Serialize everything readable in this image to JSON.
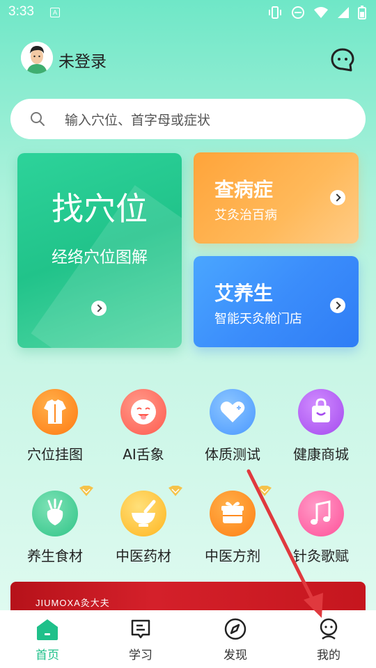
{
  "status_bar": {
    "time": "3:33",
    "notification_glyph": "A"
  },
  "header": {
    "user_name": "未登录"
  },
  "search": {
    "placeholder": "输入穴位、首字母或症状"
  },
  "cards": {
    "main": {
      "title": "找穴位",
      "subtitle": "经络穴位图解"
    },
    "disease": {
      "title": "查病症",
      "subtitle": "艾灸治百病"
    },
    "health": {
      "title": "艾养生",
      "subtitle": "智能天灸舱门店"
    }
  },
  "grid": [
    {
      "label": "穴位挂图",
      "icon": "shirt-icon",
      "color": "#ff8a1f"
    },
    {
      "label": "AI舌象",
      "icon": "face-icon",
      "color": "#ff6a5e"
    },
    {
      "label": "体质测试",
      "icon": "heart-icon",
      "color": "#5aa9ff"
    },
    {
      "label": "健康商城",
      "icon": "shopping-bag-icon",
      "color": "#b25cf0"
    },
    {
      "label": "养生食材",
      "icon": "radish-icon",
      "color": "#35c98e",
      "vip": true
    },
    {
      "label": "中医药材",
      "icon": "mortar-icon",
      "color": "#ffbf2e",
      "vip": true
    },
    {
      "label": "中医方剂",
      "icon": "gift-box-icon",
      "color": "#ff8a1f",
      "vip": true
    },
    {
      "label": "针灸歌赋",
      "icon": "music-note-icon",
      "color": "#ff5fa0"
    }
  ],
  "banner": {
    "text": "JIUMOXA灸大夫"
  },
  "tabs": [
    {
      "label": "首页",
      "icon": "home-icon",
      "active": true
    },
    {
      "label": "学习",
      "icon": "notes-icon",
      "active": false
    },
    {
      "label": "发现",
      "icon": "compass-icon",
      "active": false
    },
    {
      "label": "我的",
      "icon": "profile-icon",
      "active": false
    }
  ],
  "colors": {
    "accent": "#1fc08a",
    "tab_inactive": "#333333",
    "annotation_arrow": "#e0393e"
  }
}
